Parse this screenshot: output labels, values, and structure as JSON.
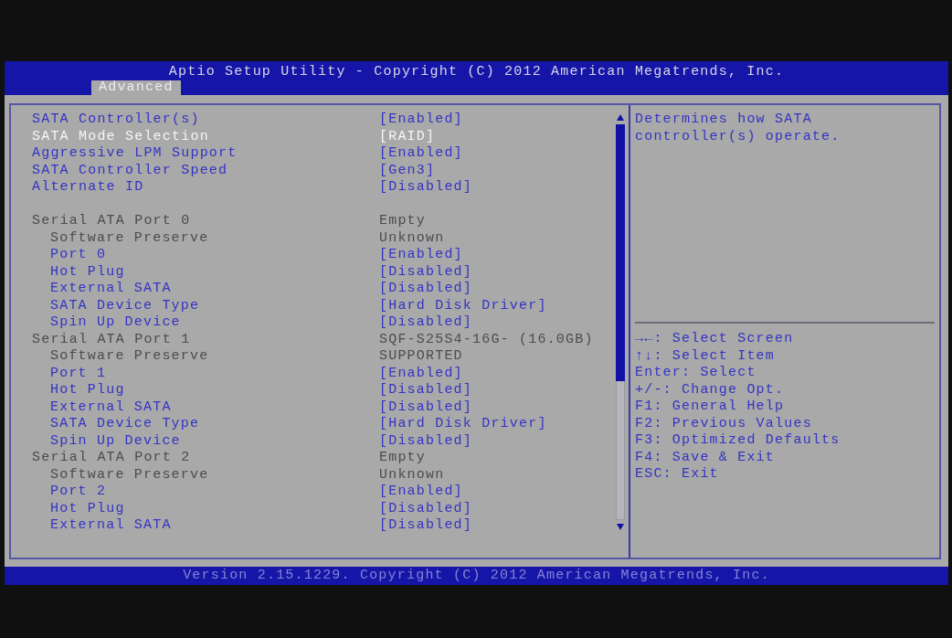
{
  "header": {
    "title": "Aptio Setup Utility - Copyright (C) 2012 American Megatrends, Inc.",
    "tabs": [
      {
        "label": "Advanced",
        "selected": true
      }
    ]
  },
  "settings": [
    {
      "kind": "setting",
      "label": "SATA Controller(s)",
      "value": "[Enabled]",
      "selected": false
    },
    {
      "kind": "setting",
      "label": "SATA Mode Selection",
      "value": "[RAID]",
      "selected": true
    },
    {
      "kind": "setting",
      "label": "Aggressive LPM Support",
      "value": "[Enabled]",
      "selected": false
    },
    {
      "kind": "setting",
      "label": "SATA Controller Speed",
      "value": "[Gen3]",
      "selected": false
    },
    {
      "kind": "setting",
      "label": "Alternate ID",
      "value": "[Disabled]",
      "selected": false
    }
  ],
  "ports": [
    {
      "kind": "info",
      "label": "Serial ATA Port 0",
      "value": "Empty",
      "selected": false,
      "children": [
        {
          "kind": "info",
          "label": "Software Preserve",
          "value": "Unknown",
          "selected": false
        },
        {
          "kind": "setting",
          "label": "Port 0",
          "value": "[Enabled]",
          "selected": false
        },
        {
          "kind": "setting",
          "label": "Hot Plug",
          "value": "[Disabled]",
          "selected": false
        },
        {
          "kind": "setting",
          "label": "External SATA",
          "value": "[Disabled]",
          "selected": false
        },
        {
          "kind": "setting",
          "label": "SATA Device Type",
          "value": "[Hard Disk Driver]",
          "selected": false
        },
        {
          "kind": "setting",
          "label": "Spin Up Device",
          "value": "[Disabled]",
          "selected": false
        }
      ]
    },
    {
      "kind": "info",
      "label": "Serial ATA Port 1",
      "value": "SQF-S25S4-16G- (16.0GB)",
      "selected": false,
      "children": [
        {
          "kind": "info",
          "label": "Software Preserve",
          "value": "SUPPORTED",
          "selected": false
        },
        {
          "kind": "setting",
          "label": "Port 1",
          "value": "[Enabled]",
          "selected": false
        },
        {
          "kind": "setting",
          "label": "Hot Plug",
          "value": "[Disabled]",
          "selected": false
        },
        {
          "kind": "setting",
          "label": "External SATA",
          "value": "[Disabled]",
          "selected": false
        },
        {
          "kind": "setting",
          "label": "SATA Device Type",
          "value": "[Hard Disk Driver]",
          "selected": false
        },
        {
          "kind": "setting",
          "label": "Spin Up Device",
          "value": "[Disabled]",
          "selected": false
        }
      ]
    },
    {
      "kind": "info",
      "label": "Serial ATA Port 2",
      "value": "Empty",
      "selected": false,
      "children": [
        {
          "kind": "info",
          "label": "Software Preserve",
          "value": "Unknown",
          "selected": false
        },
        {
          "kind": "setting",
          "label": "Port 2",
          "value": "[Enabled]",
          "selected": false
        },
        {
          "kind": "setting",
          "label": "Hot Plug",
          "value": "[Disabled]",
          "selected": false
        },
        {
          "kind": "setting",
          "label": "External SATA",
          "value": "[Disabled]",
          "selected": false
        }
      ]
    }
  ],
  "help": {
    "description": "Determines how SATA controller(s) operate."
  },
  "key_hints": [
    "→←: Select Screen",
    "↑↓: Select Item",
    "Enter: Select",
    "+/-: Change Opt.",
    "F1: General Help",
    "F2: Previous Values",
    "F3: Optimized Defaults",
    "F4: Save & Exit",
    "ESC: Exit"
  ],
  "footer": {
    "text": "Version 2.15.1229. Copyright (C) 2012 American Megatrends, Inc."
  }
}
